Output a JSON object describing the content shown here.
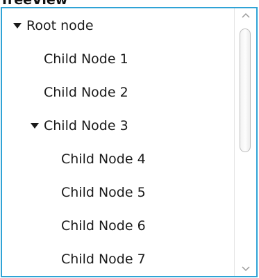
{
  "header": {
    "title": "TreeView"
  },
  "tree": {
    "nodes": [
      {
        "label": "Root node",
        "level": 0,
        "expanded": true,
        "icon": "triangle-down-icon"
      },
      {
        "label": "Child Node 1",
        "level": 1,
        "expanded": null
      },
      {
        "label": "Child Node 2",
        "level": 1,
        "expanded": null
      },
      {
        "label": "Child Node 3",
        "level": 1,
        "expanded": true,
        "icon": "triangle-down-icon"
      },
      {
        "label": "Child Node 4",
        "level": 2,
        "expanded": null
      },
      {
        "label": "Child Node 5",
        "level": 2,
        "expanded": null
      },
      {
        "label": "Child Node 6",
        "level": 2,
        "expanded": null
      },
      {
        "label": "Child Node 7",
        "level": 2,
        "expanded": null
      }
    ]
  },
  "scrollbar": {
    "up_icon": "chevron-up-icon",
    "down_icon": "chevron-down-icon",
    "position": 0
  },
  "colors": {
    "focus_border": "#2fa3d6",
    "text": "#1a1a1a",
    "background": "#ffffff"
  }
}
